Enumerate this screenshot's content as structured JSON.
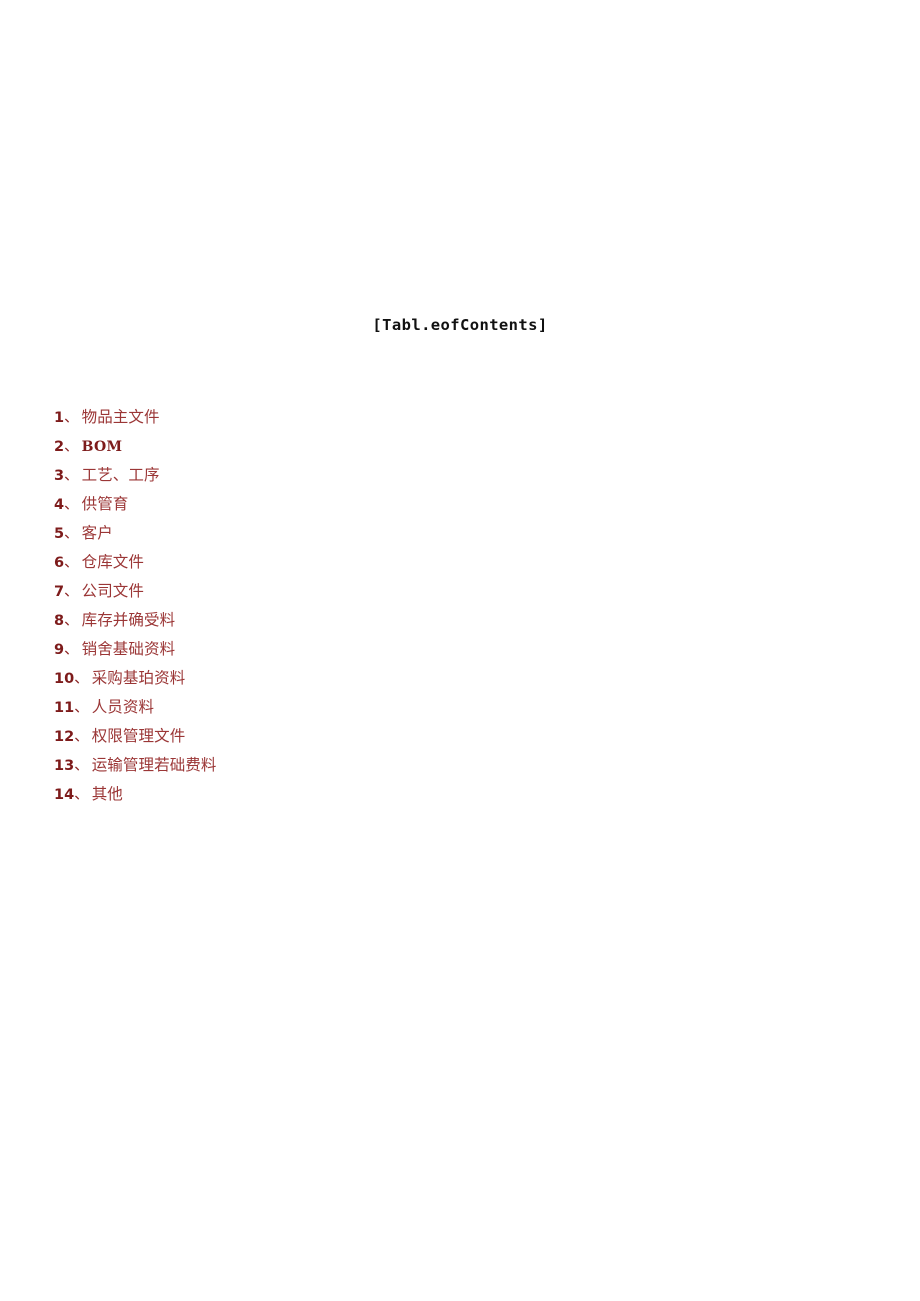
{
  "document": {
    "title": "[Tabl.eofContents]",
    "background_color": "#ffffff",
    "title_color": "#111111",
    "index_color": "#7d1b1b",
    "label_color": "#9b3636"
  },
  "toc": {
    "items": [
      {
        "index": "1",
        "separator": "、",
        "label": "物品主文件",
        "script": "cjk"
      },
      {
        "index": "2",
        "separator": "、",
        "label": "BOM",
        "script": "latin"
      },
      {
        "index": "3",
        "separator": "、",
        "label": "工艺、工序",
        "script": "cjk"
      },
      {
        "index": "4",
        "separator": "、",
        "label": "供管育",
        "script": "cjk"
      },
      {
        "index": "5",
        "separator": "、",
        "label": "客户",
        "script": "cjk"
      },
      {
        "index": "6",
        "separator": "、",
        "label": "仓库文件",
        "script": "cjk"
      },
      {
        "index": "7",
        "separator": "、",
        "label": "公司文件",
        "script": "cjk"
      },
      {
        "index": "8",
        "separator": "、",
        "label": "库存并确受料",
        "script": "cjk"
      },
      {
        "index": "9",
        "separator": "、",
        "label": "销舍基础资料",
        "script": "cjk"
      },
      {
        "index": "10",
        "separator": "、",
        "label": "采购基珀资料",
        "script": "cjk"
      },
      {
        "index": "11",
        "separator": "、",
        "label": "人员资料",
        "script": "cjk"
      },
      {
        "index": "12",
        "separator": "、",
        "label": "权限管理文件",
        "script": "cjk"
      },
      {
        "index": "13",
        "separator": "、",
        "label": "运输管理若础费料",
        "script": "cjk"
      },
      {
        "index": "14",
        "separator": "、",
        "label": "其他",
        "script": "cjk"
      }
    ]
  }
}
